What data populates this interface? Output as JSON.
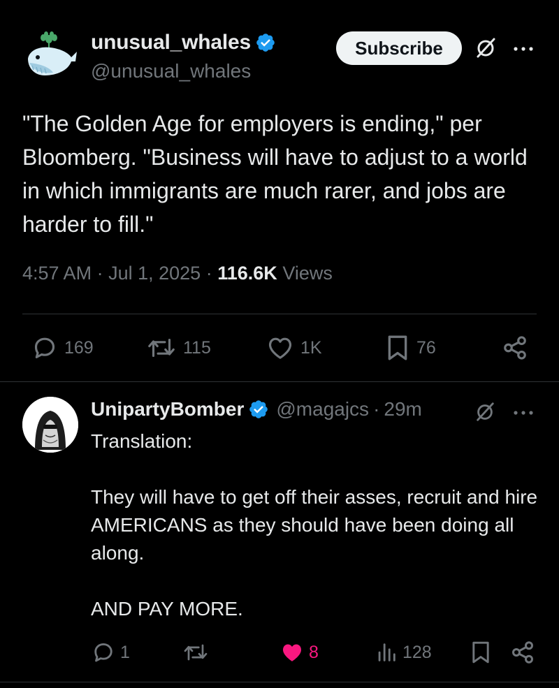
{
  "main_tweet": {
    "display_name": "unusual_whales",
    "handle": "@unusual_whales",
    "subscribe_label": "Subscribe",
    "text": "\"The Golden Age for employers is ending,\" per Bloomberg. \"Business will have to adjust to a world in which immigrants are much rarer, and jobs are harder to fill.\"",
    "time": "4:57 AM",
    "date": "Jul 1, 2025",
    "separator": "·",
    "views_count": "116.6K",
    "views_label": "Views",
    "replies": "169",
    "reposts": "115",
    "likes": "1K",
    "bookmarks": "76"
  },
  "reply": {
    "display_name": "UnipartyBomber",
    "handle": "@magajcs",
    "separator": "·",
    "time_ago": "29m",
    "text": "Translation:\n\nThey will have to get off their asses, recruit and hire AMERICANS as they should have been doing all along.\n\nAND PAY MORE.",
    "replies": "1",
    "likes": "8",
    "views": "128"
  },
  "colors": {
    "background": "#000000",
    "text_primary": "#e7e9ea",
    "text_secondary": "#71767b",
    "verified_blue": "#1d9bf0",
    "like_pink": "#f91880",
    "divider": "#2f3336"
  },
  "icons": {
    "avatar_main": "whale-logo",
    "avatar_reply": "hooded-figure-sketch",
    "verified": "verified-badge-icon",
    "grok": "grok-slash-icon",
    "more": "more-dots-icon",
    "reply": "reply-bubble-icon",
    "repost": "repost-arrows-icon",
    "like": "heart-icon",
    "bookmark": "bookmark-icon",
    "share": "share-icon",
    "views": "views-bars-icon"
  }
}
